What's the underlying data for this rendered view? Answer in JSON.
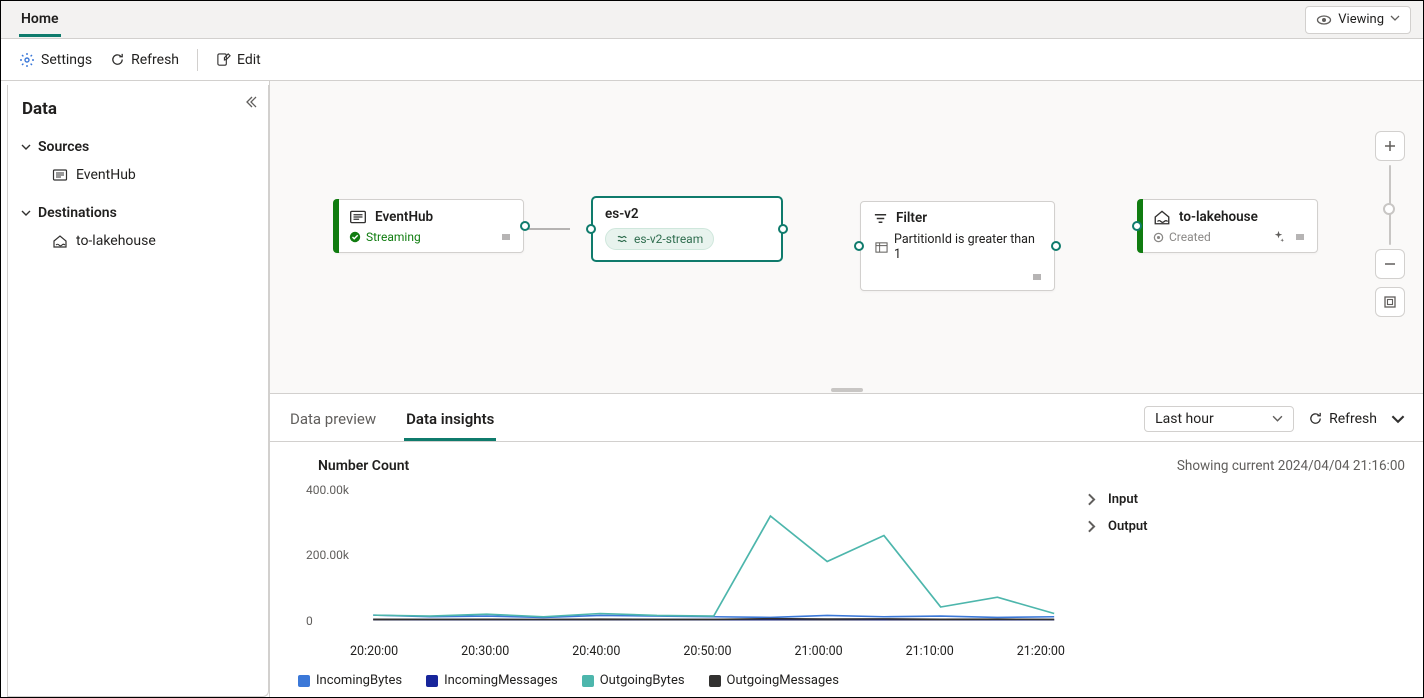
{
  "header": {
    "home_tab": "Home",
    "mode_label": "Viewing"
  },
  "toolbar": {
    "settings": "Settings",
    "refresh": "Refresh",
    "edit": "Edit"
  },
  "left_panel": {
    "title": "Data",
    "sources_label": "Sources",
    "sources": [
      {
        "label": "EventHub"
      }
    ],
    "destinations_label": "Destinations",
    "destinations": [
      {
        "label": "to-lakehouse"
      }
    ]
  },
  "nodes": {
    "source": {
      "title": "EventHub",
      "status": "Streaming"
    },
    "stream": {
      "title": "es-v2",
      "pill": "es-v2-stream"
    },
    "filter": {
      "title": "Filter",
      "detail": "PartitionId is greater than 1"
    },
    "dest": {
      "title": "to-lakehouse",
      "status": "Created"
    }
  },
  "insights": {
    "tabs": {
      "preview": "Data preview",
      "insights": "Data insights"
    },
    "time_range": "Last hour",
    "refresh": "Refresh",
    "chart_title": "Number Count",
    "showing": "Showing current 2024/04/04 21:16:00",
    "acc_input": "Input",
    "acc_output": "Output",
    "legend": {
      "in_bytes": "IncomingBytes",
      "in_msgs": "IncomingMessages",
      "out_bytes": "OutgoingBytes",
      "out_msgs": "OutgoingMessages"
    },
    "yticks": {
      "t0": "0",
      "t1": "200.00k",
      "t2": "400.00k"
    },
    "xticks": [
      "20:20:00",
      "20:30:00",
      "20:40:00",
      "20:50:00",
      "21:00:00",
      "21:10:00",
      "21:20:00"
    ]
  },
  "chart_data": {
    "type": "line",
    "title": "Number Count",
    "ylabel": "",
    "xlabel": "",
    "ylim": [
      0,
      400000
    ],
    "x": [
      "20:20:00",
      "20:25:00",
      "20:30:00",
      "20:35:00",
      "20:40:00",
      "20:45:00",
      "20:50:00",
      "20:55:00",
      "21:00:00",
      "21:05:00",
      "21:10:00",
      "21:15:00",
      "21:20:00"
    ],
    "series": [
      {
        "name": "IncomingBytes",
        "color": "#3b78d8",
        "values": [
          15000,
          10000,
          12000,
          8000,
          14000,
          12000,
          10000,
          8000,
          14000,
          10000,
          12000,
          8000,
          10000
        ]
      },
      {
        "name": "IncomingMessages",
        "color": "#17259b",
        "values": [
          2000,
          1500,
          1800,
          1200,
          2000,
          1600,
          1500,
          1200,
          2000,
          1500,
          1700,
          1200,
          1500
        ]
      },
      {
        "name": "OutgoingBytes",
        "color": "#4db6ac",
        "values": [
          15000,
          12000,
          18000,
          10000,
          20000,
          14000,
          12000,
          320000,
          180000,
          260000,
          40000,
          70000,
          20000
        ]
      },
      {
        "name": "OutgoingMessages",
        "color": "#323130",
        "values": [
          2000,
          1800,
          2200,
          1500,
          2400,
          1800,
          1600,
          4000,
          3000,
          3500,
          2000,
          2500,
          1800
        ]
      }
    ]
  }
}
